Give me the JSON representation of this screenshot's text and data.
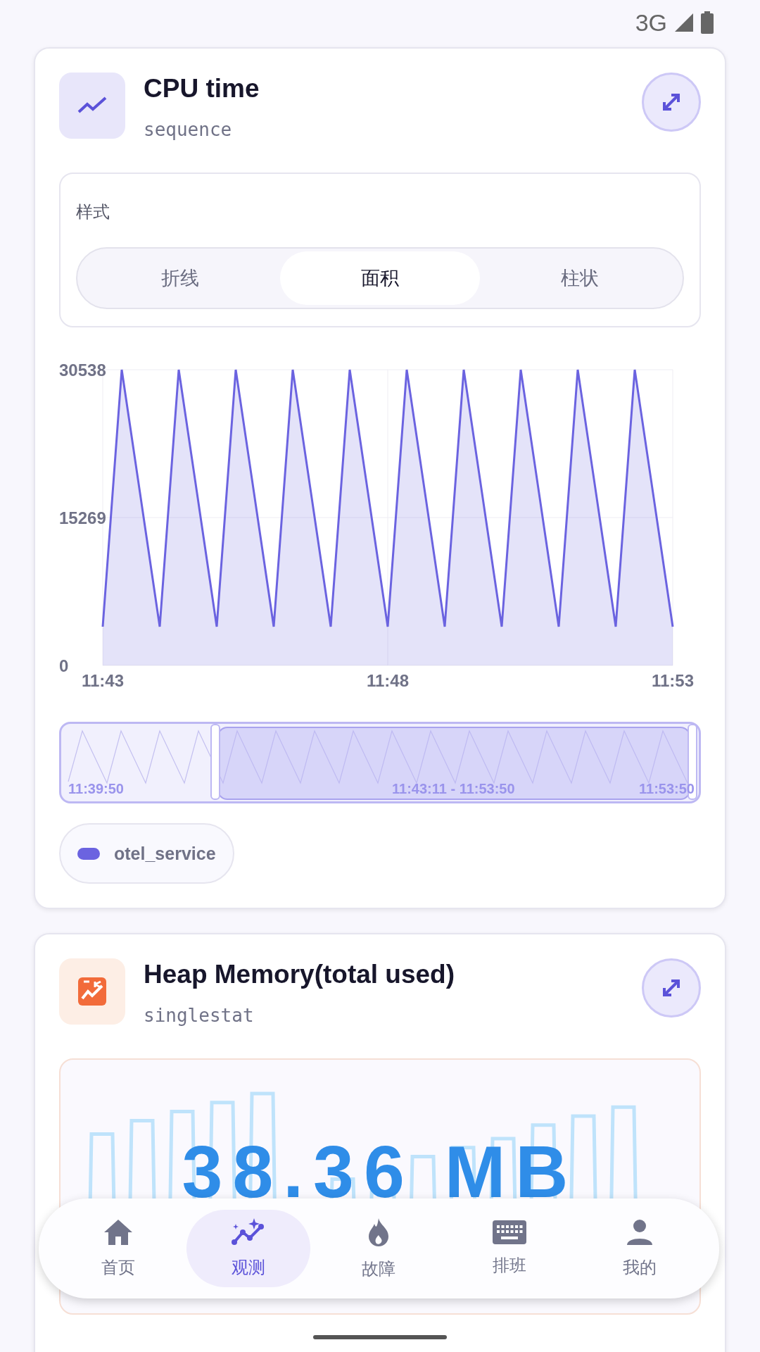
{
  "status_bar": {
    "network": "3G"
  },
  "cards": [
    {
      "title": "CPU time",
      "subtitle": "sequence",
      "style_picker": {
        "label": "样式",
        "options": [
          {
            "label": "折线",
            "selected": false
          },
          {
            "label": "面积",
            "selected": true
          },
          {
            "label": "柱状",
            "selected": false
          }
        ]
      },
      "chart_data": {
        "type": "area",
        "ylim": [
          0,
          30538
        ],
        "yticks": [
          0,
          15269,
          30538
        ],
        "categories": [
          "11:43",
          null,
          null,
          null,
          null,
          null,
          null,
          null,
          null,
          null,
          null,
          null,
          null,
          null,
          null,
          "11:48",
          null,
          null,
          null,
          null,
          null,
          null,
          null,
          null,
          null,
          null,
          null,
          null,
          null,
          null,
          "11:53"
        ],
        "series": [
          {
            "name": "otel_service",
            "color": "#6b63e0",
            "values": [
              4000,
              30538,
              17300,
              4000,
              30538,
              17300,
              4000,
              30538,
              17300,
              4000,
              30538,
              17300,
              4000,
              30538,
              17300,
              4000,
              30538,
              17300,
              4000,
              30538,
              17300,
              4000,
              30538,
              17300,
              4000,
              30538,
              17300,
              4000,
              30538,
              17300,
              4000
            ]
          }
        ]
      },
      "range": {
        "start_label": "11:39:50",
        "selection_label": "11:43:11 - 11:53:50",
        "end_label": "11:53:50"
      }
    },
    {
      "title": "Heap Memory(total used)",
      "subtitle": "singlestat",
      "value": "38.36 MB"
    }
  ],
  "nav": [
    {
      "label": "首页",
      "selected": false
    },
    {
      "label": "观测",
      "selected": true
    },
    {
      "label": "故障",
      "selected": false
    },
    {
      "label": "排班",
      "selected": false
    },
    {
      "label": "我的",
      "selected": false
    }
  ]
}
